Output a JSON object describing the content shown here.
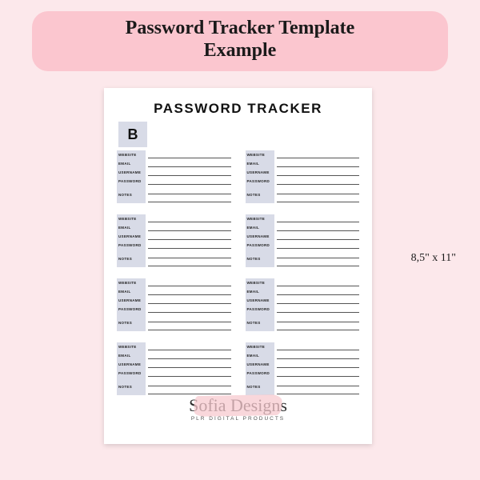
{
  "title_line1": "Password Tracker Template",
  "title_line2": "Example",
  "dimensions": "8,5\" x 11\"",
  "page_heading": "PASSWORD TRACKER",
  "index_letter": "B",
  "field_labels": {
    "website": "WEBSITE",
    "email": "EMAIL",
    "username": "USERNAME",
    "password": "PASSWORD",
    "notes": "NOTES"
  },
  "watermark": {
    "brand": "Sofia Designs",
    "subtitle": "PLR DIGITAL PRODUCTS"
  }
}
